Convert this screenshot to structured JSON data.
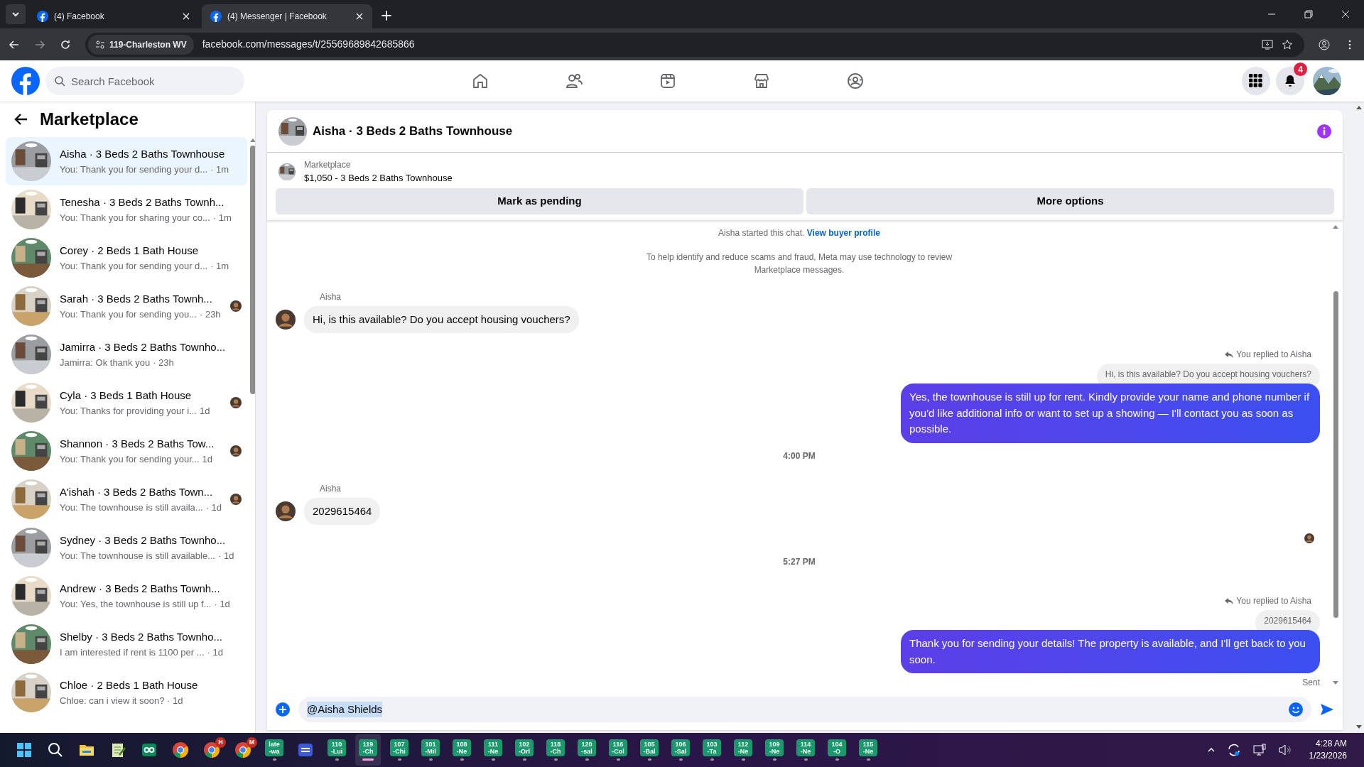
{
  "browser": {
    "tabs": [
      {
        "title": "(4) Facebook",
        "selected": false
      },
      {
        "title": "(4) Messenger | Facebook",
        "selected": true
      }
    ],
    "site_chip": "119-Charleston WV",
    "url": "facebook.com/messages/t/25569689842685866"
  },
  "header": {
    "search": {
      "placeholder": "Search Facebook"
    },
    "notification_count": "4"
  },
  "sidebar": {
    "title": "Marketplace",
    "conversations": [
      {
        "title": "Aisha · 3 Beds 2 Baths Townhouse",
        "preview": "You: Thank you for sending your d...",
        "time": "· 1m",
        "selected": true,
        "seen": false
      },
      {
        "title": "Tenesha · 3 Beds 2 Baths Townh...",
        "preview": "You: Thank you for sharing your co...",
        "time": "· 1m",
        "selected": false,
        "seen": false
      },
      {
        "title": "Corey · 2 Beds 1 Bath House",
        "preview": "You: Thank you for sending your d...",
        "time": "· 1m",
        "selected": false,
        "seen": false
      },
      {
        "title": "Sarah · 3 Beds 2 Baths Townh...",
        "preview": "You: Thank you for sending you...",
        "time": "· 23h",
        "selected": false,
        "seen": true
      },
      {
        "title": "Jamirra · 3 Beds 2 Baths Townho...",
        "preview": "Jamirra: Ok thank you",
        "time": "· 23h",
        "selected": false,
        "seen": false
      },
      {
        "title": "Cyla · 3 Beds 1 Bath House",
        "preview": "You: Thanks for providing your i...",
        "time": "1d",
        "selected": false,
        "seen": true
      },
      {
        "title": "Shannon · 3 Beds 2 Baths Tow...",
        "preview": "You: Thank you for sending your...",
        "time": "1d",
        "selected": false,
        "seen": true
      },
      {
        "title": "A'ishah · 3 Beds 2 Baths Town...",
        "preview": "You: The townhouse is still availa...",
        "time": "· 1d",
        "selected": false,
        "seen": true
      },
      {
        "title": "Sydney · 3 Beds 2 Baths Townho...",
        "preview": "You: The townhouse is still available...",
        "time": "· 1d",
        "selected": false,
        "seen": false
      },
      {
        "title": "Andrew · 3 Beds 2 Baths Townh...",
        "preview": "You: Yes, the townhouse is still up f...",
        "time": "· 1d",
        "selected": false,
        "seen": false
      },
      {
        "title": "Shelby · 3 Beds 2 Baths Townho...",
        "preview": "I am interested if rent is 1100 per ...",
        "time": "· 1d",
        "selected": false,
        "seen": false
      },
      {
        "title": "Chloe · 2 Beds 1 Bath House",
        "preview": "Chloe: can i view it soon? · 1d",
        "selected": false,
        "seen": false
      }
    ]
  },
  "chat": {
    "title": "Aisha · 3 Beds 2 Baths Townhouse",
    "listing_label": "Marketplace",
    "listing": "$1,050 - 3 Beds 2 Baths Townhouse",
    "actions": [
      "Mark as pending",
      "More options"
    ],
    "messages": [
      {
        "kind": "system",
        "text": "Aisha started this chat. ",
        "link": "View buyer profile"
      },
      {
        "kind": "notice",
        "text": "To help identify and reduce scams and fraud, Meta may use technology to review Marketplace messages."
      },
      {
        "kind": "incoming",
        "sender": "Aisha",
        "text": "Hi, is this available? Do you accept housing vouchers?"
      },
      {
        "kind": "outgoing",
        "reply_label": "You replied to Aisha",
        "quoted": "Hi, is this available? Do you accept housing vouchers?",
        "text": "Yes, the townhouse is still up for rent. Kindly provide your name and phone number if you'd like additional info or want to set up a showing — I'll contact you as soon as possible."
      },
      {
        "kind": "time",
        "text": "4:00 PM"
      },
      {
        "kind": "incoming",
        "sender": "Aisha",
        "text": "2029615464"
      },
      {
        "kind": "seen"
      },
      {
        "kind": "time",
        "text": "5:27 PM"
      },
      {
        "kind": "outgoing",
        "reply_label": "You replied to Aisha",
        "quoted": "2029615464",
        "text": "Thank you for sending your details! The property is available, and I'll get back to you soon."
      },
      {
        "kind": "status",
        "text": "Sent"
      }
    ],
    "composer": {
      "value": "@Aisha Shields"
    }
  },
  "taskbar": {
    "apps": [
      {
        "kind": "icon"
      },
      {
        "kind": "icon"
      },
      {
        "kind": "icon"
      },
      {
        "kind": "icon"
      },
      {
        "kind": "icon"
      },
      {
        "kind": "chrome"
      },
      {
        "kind": "chrome",
        "badge": "H"
      },
      {
        "kind": "chrome",
        "badge": "M"
      },
      {
        "kind": "tile",
        "lines": [
          "late",
          "-wa"
        ],
        "selected": false
      },
      {
        "kind": "icon"
      },
      {
        "kind": "tile",
        "lines": [
          "110",
          "-Lui"
        ],
        "selected": false
      },
      {
        "kind": "tile",
        "lines": [
          "119",
          "-Ch"
        ],
        "selected": true
      },
      {
        "kind": "tile",
        "lines": [
          "107",
          "-Chi"
        ],
        "selected": false
      },
      {
        "kind": "tile",
        "lines": [
          "101",
          "-Mil"
        ],
        "selected": false
      },
      {
        "kind": "tile",
        "lines": [
          "108",
          "-Ne"
        ],
        "selected": false
      },
      {
        "kind": "tile",
        "lines": [
          "111",
          "-Ne"
        ],
        "selected": false
      },
      {
        "kind": "tile",
        "lines": [
          "102",
          "-Orl"
        ],
        "selected": false
      },
      {
        "kind": "tile",
        "lines": [
          "118",
          "-Ch"
        ],
        "selected": false
      },
      {
        "kind": "tile",
        "lines": [
          "120",
          "-sal"
        ],
        "selected": false
      },
      {
        "kind": "tile",
        "lines": [
          "116",
          "-Col"
        ],
        "selected": false
      },
      {
        "kind": "tile",
        "lines": [
          "105",
          "-Bal"
        ],
        "selected": false
      },
      {
        "kind": "tile",
        "lines": [
          "106",
          "-Sal"
        ],
        "selected": false
      },
      {
        "kind": "tile",
        "lines": [
          "103",
          "-Ta"
        ],
        "selected": false
      },
      {
        "kind": "tile",
        "lines": [
          "112",
          "-Ne"
        ],
        "selected": false
      },
      {
        "kind": "tile",
        "lines": [
          "109",
          "-Ne"
        ],
        "selected": false
      },
      {
        "kind": "tile",
        "lines": [
          "114",
          "-Ne"
        ],
        "selected": false
      },
      {
        "kind": "tile",
        "lines": [
          "104",
          "-O"
        ],
        "selected": false
      },
      {
        "kind": "tile",
        "lines": [
          "115",
          "-Ne"
        ],
        "selected": false
      }
    ],
    "time": "4:28 AM",
    "date": "1/23/2026"
  }
}
